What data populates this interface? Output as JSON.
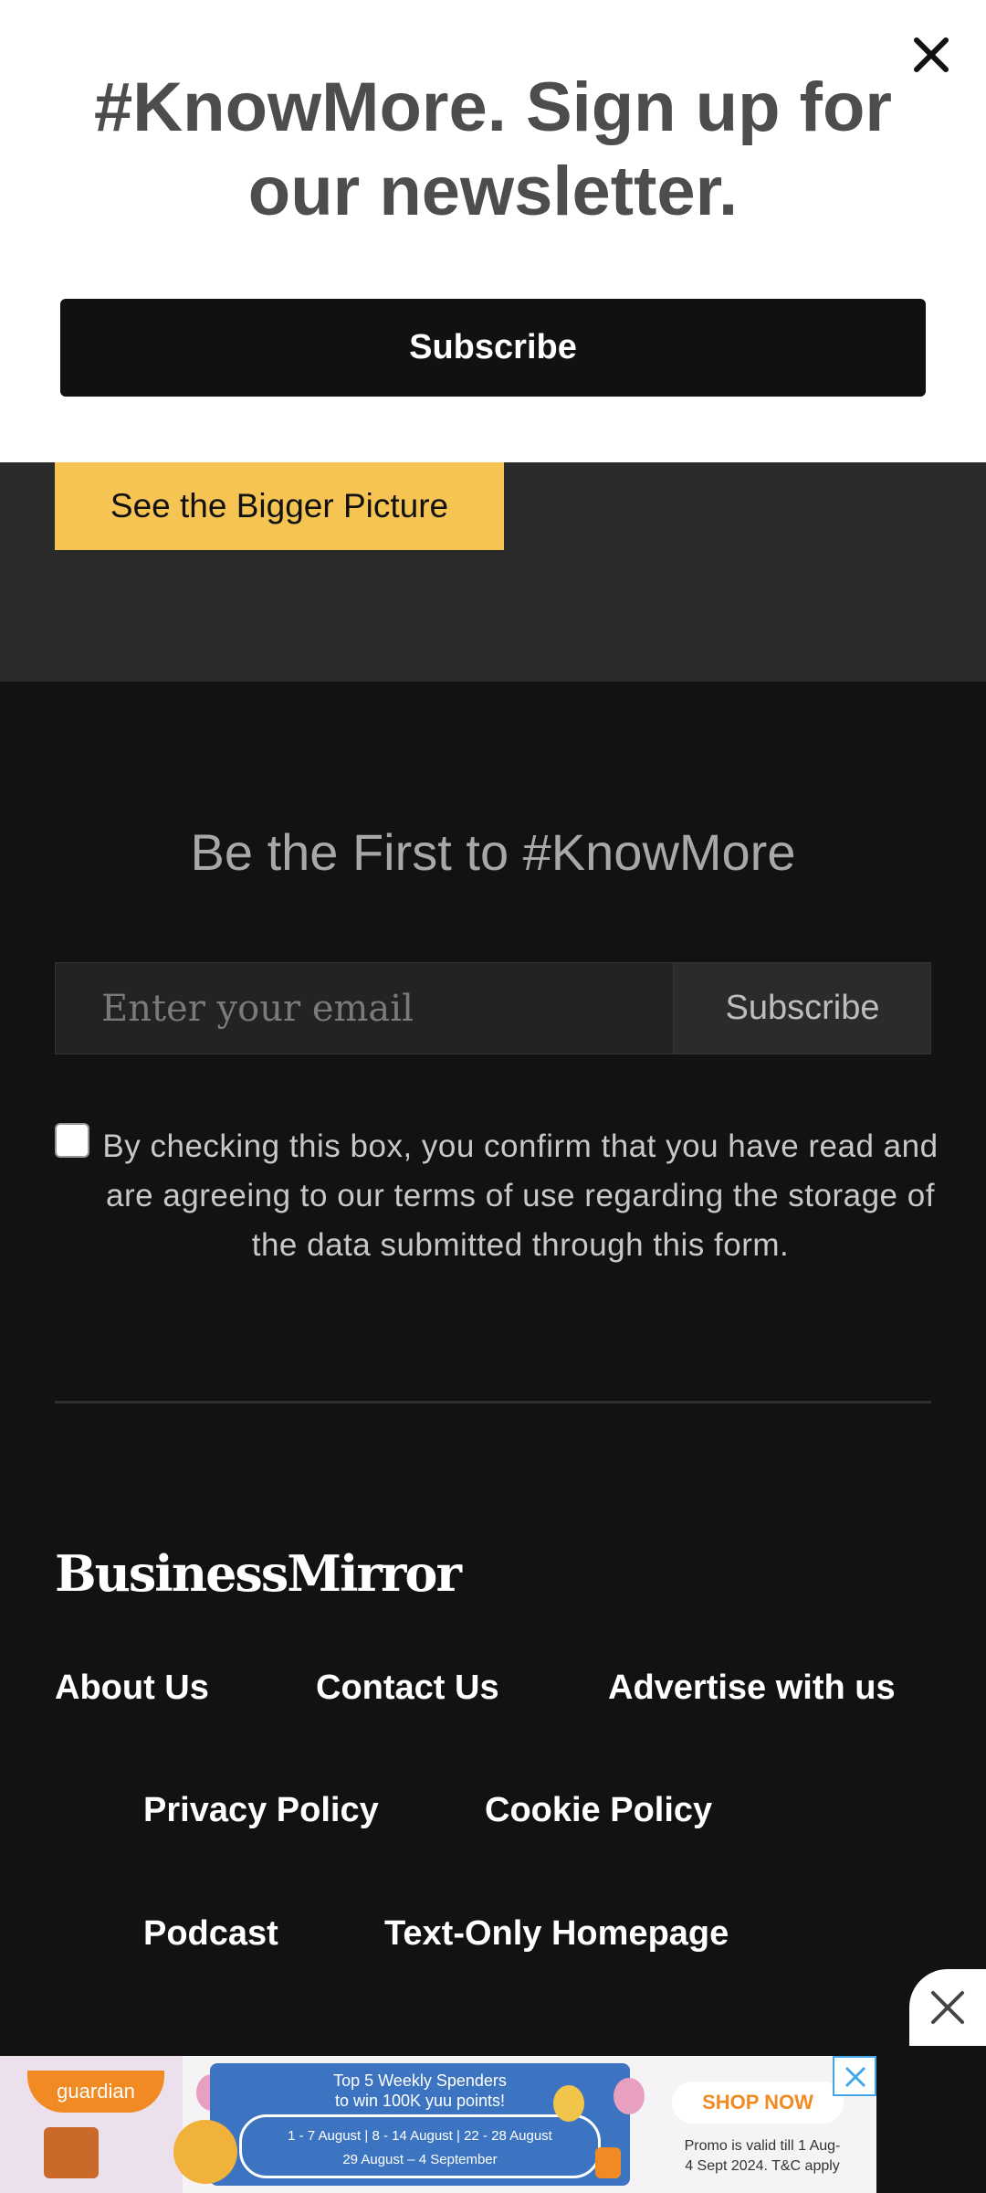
{
  "popup": {
    "title": "#KnowMore. Sign up for our newsletter.",
    "subscribe_label": "Subscribe"
  },
  "hero": {
    "cta_label": "See the Bigger Picture"
  },
  "newsletter": {
    "heading": "Be the First to #KnowMore",
    "email_placeholder": "Enter your email",
    "submit_label": "Subscribe",
    "consent_text": "By checking this box, you confirm that you have read and are agreeing to our terms of use regarding the storage of the data submitted through this form.",
    "consent_checked": false
  },
  "footer": {
    "logo_text": "BusinessMirror",
    "links": [
      "About Us",
      "Contact Us",
      "Advertise with us",
      "Privacy Policy",
      "Cookie Policy",
      "Podcast",
      "Text-Only Homepage"
    ]
  },
  "ad": {
    "brand": "guardian",
    "headline_1": "Top 5 Weekly Spenders",
    "headline_2": "to win 100K yuu points!",
    "dates_1": "1 - 7 August  |  8 - 14 August  |  22 - 28 August",
    "dates_2": "29 August – 4 September",
    "cta": "SHOP NOW",
    "promo_1": "Promo is valid till 1 Aug-",
    "promo_2": "4 Sept 2024. T&C apply"
  },
  "colors": {
    "accent_yellow": "#f6c453",
    "footer_bg": "#121212",
    "section_bg": "#2a2a2a",
    "ad_orange": "#f28a24",
    "ad_blue": "#3d74c2"
  }
}
